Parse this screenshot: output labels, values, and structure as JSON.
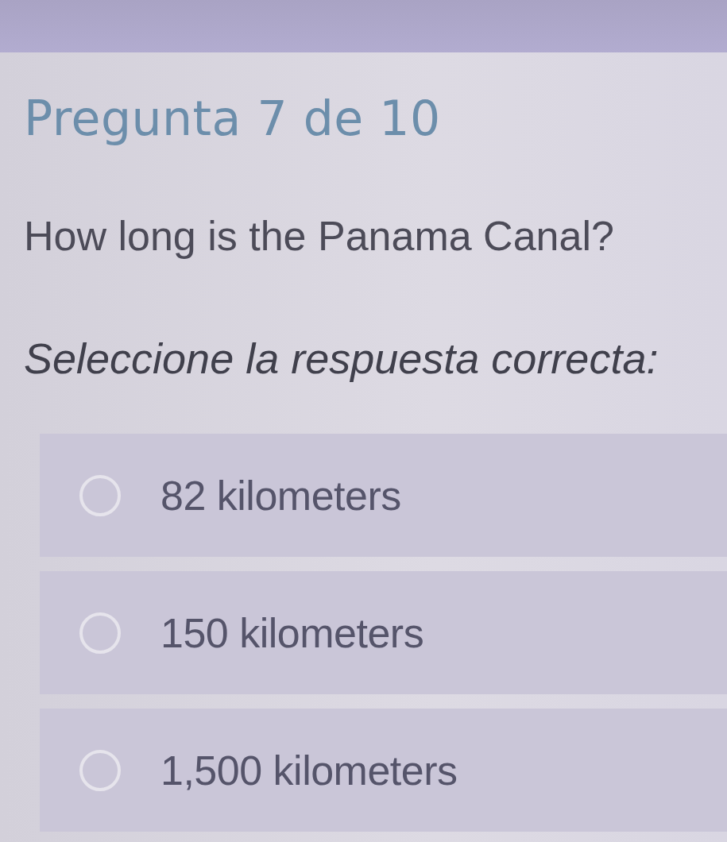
{
  "title": "Pregunta 7 de 10",
  "question": "How long is the Panama Canal?",
  "instruction": "Seleccione la respuesta correcta:",
  "options": [
    {
      "label": "82 kilometers",
      "selected": false
    },
    {
      "label": "150 kilometers",
      "selected": false
    },
    {
      "label": "1,500 kilometers",
      "selected": false
    }
  ]
}
